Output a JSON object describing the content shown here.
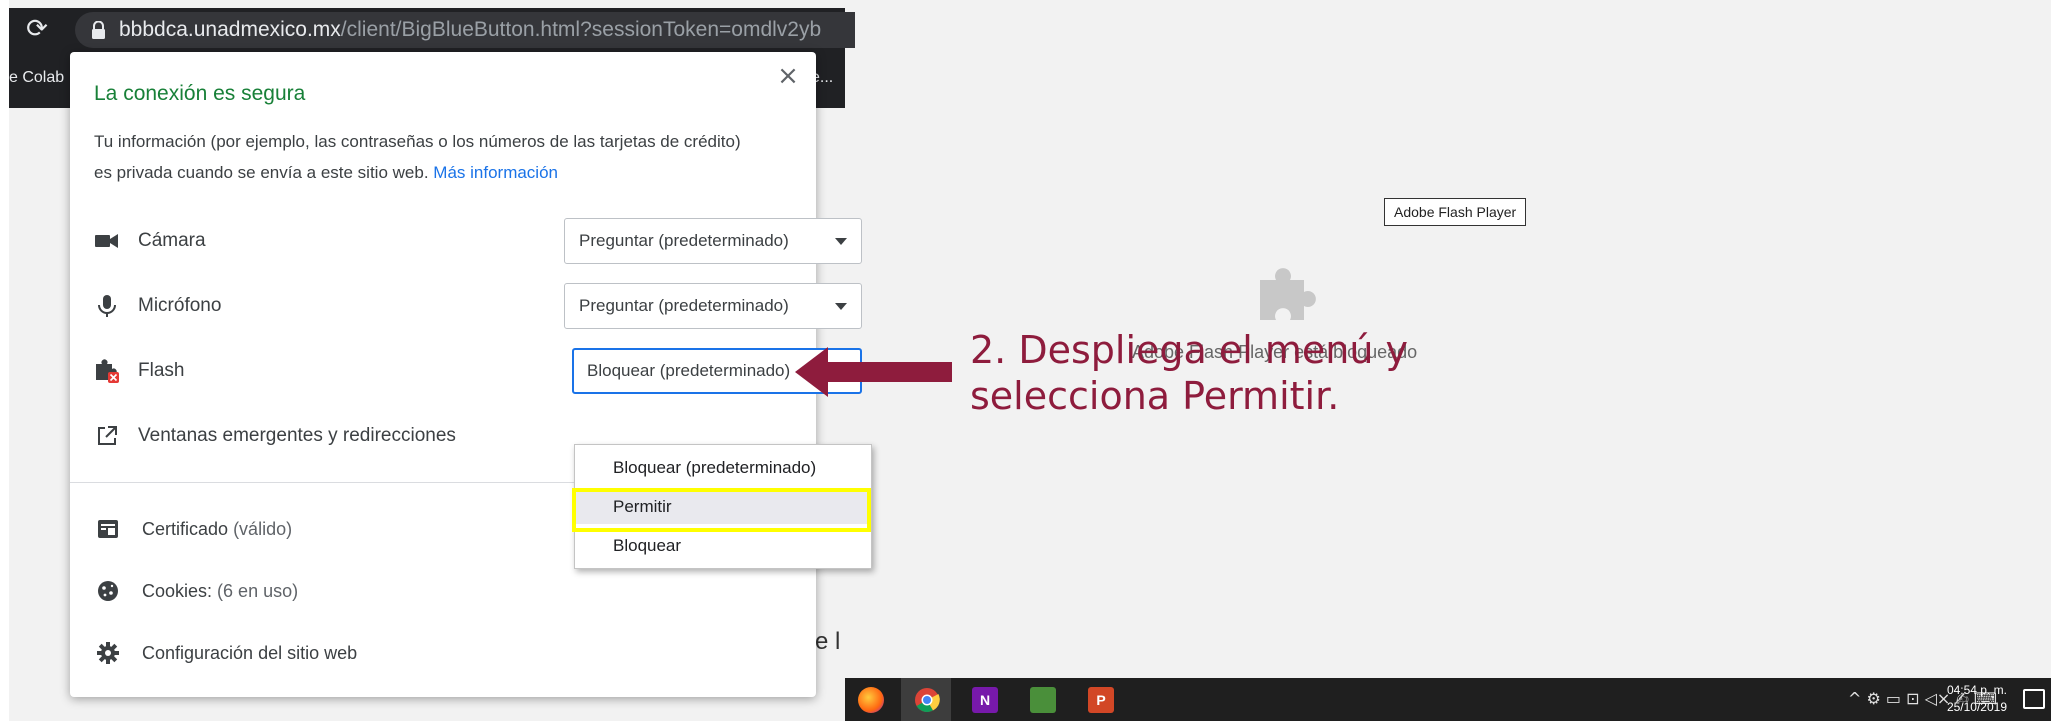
{
  "browser": {
    "url_host": "bbbdca.unadmexico.mx",
    "url_path": "/client/BigBlueButton.html?sessionToken=omdlv2yb",
    "bookmark_left": "e Colab",
    "bookmark_right": "ce..."
  },
  "popup": {
    "close_glyph": "×",
    "title": "La conexión es segura",
    "info_text": "Tu información (por ejemplo, las contraseñas o los números de las tarjetas de crédito) es privada cuando se envía a este sitio web.",
    "info_link": "Más información",
    "permissions": [
      {
        "icon": "camera-icon",
        "label": "Cámara",
        "value": "Preguntar (predeterminado)"
      },
      {
        "icon": "microphone-icon",
        "label": "Micrófono",
        "value": "Preguntar (predeterminado)"
      },
      {
        "icon": "flash-plugin-blocked-icon",
        "label": "Flash",
        "value": "Bloquear (predeterminado)"
      },
      {
        "icon": "popup-redirect-icon",
        "label": "Ventanas emergentes y redirecciones",
        "value": ""
      }
    ],
    "flash_options": [
      "Bloquear (predeterminado)",
      "Permitir",
      "Bloquear"
    ],
    "highlighted_option": "Permitir",
    "site_items": [
      {
        "icon": "certificate-icon",
        "label": "Certificado",
        "detail": "(válido)"
      },
      {
        "icon": "cookie-icon",
        "label": "Cookies:",
        "detail": "(6 en uso)"
      },
      {
        "icon": "gear-icon",
        "label": "Configuración del sitio web",
        "detail": ""
      }
    ]
  },
  "annotation": {
    "line1": "2. Despliega el menú y",
    "line2": "selecciona Permitir.",
    "color": "#8e1c3d"
  },
  "flash_placeholder": {
    "tooltip": "Adobe Flash Player",
    "blocked_text": "Adobe Flash Player está bloqueado"
  },
  "background_text": "e l",
  "taskbar": {
    "apps": [
      {
        "name": "firefox",
        "label": ""
      },
      {
        "name": "chrome",
        "label": ""
      },
      {
        "name": "onenote",
        "label": "N"
      },
      {
        "name": "editor",
        "label": ""
      },
      {
        "name": "powerpoint",
        "label": "P"
      }
    ],
    "tray_glyphs": "^  ⚙ ▭ ⊡ ◁× ✍ ⌨",
    "time": "04:54 p. m.",
    "date": "25/10/2019"
  }
}
